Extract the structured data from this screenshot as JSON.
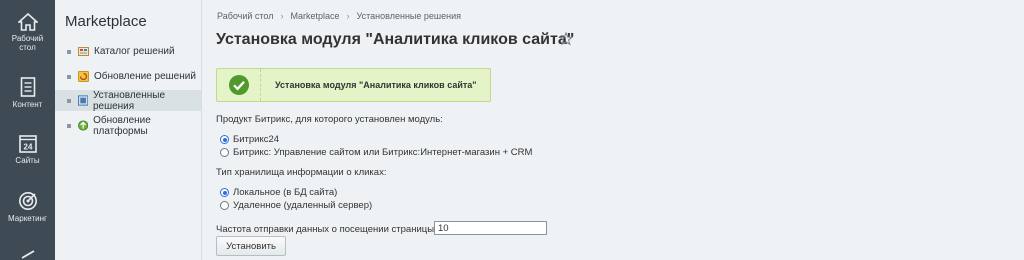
{
  "rail": {
    "items": [
      {
        "label_line1": "Рабочий",
        "label_line2": "стол",
        "icon": "home-icon"
      },
      {
        "label_line1": "Контент",
        "label_line2": "",
        "icon": "document-icon"
      },
      {
        "label_line1": "Сайты",
        "label_line2": "",
        "icon": "calendar-24-icon",
        "badge": "24"
      },
      {
        "label_line1": "Маркетинг",
        "label_line2": "",
        "icon": "target-icon"
      }
    ]
  },
  "menu": {
    "title": "Marketplace",
    "items": [
      {
        "label": "Каталог решений",
        "icon": "catalog-icon"
      },
      {
        "label": "Обновление решений",
        "icon": "update-icon"
      },
      {
        "label": "Установленные решения",
        "icon": "installed-icon",
        "active": true
      },
      {
        "label": "Обновление платформы",
        "icon": "platform-update-icon"
      }
    ]
  },
  "breadcrumb": [
    "Рабочий стол",
    "Marketplace",
    "Установленные решения"
  ],
  "page": {
    "title": "Установка модуля \"Аналитика кликов сайта\"",
    "notice": "Установка модуля \"Аналитика кликов сайта\"",
    "product_label": "Продукт Битрикс, для которого установлен модуль:",
    "product_options": [
      {
        "label": "Битрикс24",
        "checked": true
      },
      {
        "label": "Битрикс: Управление сайтом или Битрикс:Интернет-магазин + CRM",
        "checked": false
      }
    ],
    "storage_label": "Тип хранилища информации о кликах:",
    "storage_options": [
      {
        "label": "Локальное (в БД сайта)",
        "checked": true
      },
      {
        "label": "Удаленное (удаленный сервер)",
        "checked": false
      }
    ],
    "frequency_label": "Частота отправки данных о посещении страницы, с:",
    "frequency_value": "10",
    "submit_label": "Установить"
  },
  "colors": {
    "rail_bg": "#3e4a54",
    "notice_bg": "#e5f3c8",
    "success_green": "#4f9a2a",
    "radio_accent": "#2a6fd6"
  }
}
